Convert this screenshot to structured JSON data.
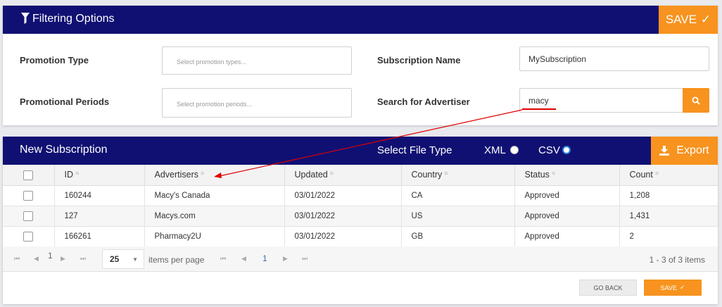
{
  "filter": {
    "title": "Filtering Options",
    "save_label": "SAVE",
    "promotion_type_label": "Promotion Type",
    "promotion_type_placeholder": "Select promotion types...",
    "promotional_periods_label": "Promotional Periods",
    "promotional_periods_placeholder": "Select promotion periods...",
    "subscription_name_label": "Subscription Name",
    "subscription_name_value": "MySubscription",
    "advertiser_label": "Search for Advertiser",
    "advertiser_value": "macy"
  },
  "subscription": {
    "title": "New Subscription",
    "file_type_label": "Select File Type",
    "options": [
      "XML",
      "CSV"
    ],
    "selected": "CSV",
    "export_label": "Export"
  },
  "table": {
    "columns": [
      "ID",
      "Advertisers",
      "Updated",
      "Country",
      "Status",
      "Count"
    ],
    "rows": [
      {
        "id": "160244",
        "advertiser": "Macy's Canada",
        "updated": "03/01/2022",
        "country": "CA",
        "status": "Approved",
        "count": "1,208"
      },
      {
        "id": "127",
        "advertiser": "Macys.com",
        "updated": "03/01/2022",
        "country": "US",
        "status": "Approved",
        "count": "1,431"
      },
      {
        "id": "166261",
        "advertiser": "Pharmacy2U",
        "updated": "03/01/2022",
        "country": "GB",
        "status": "Approved",
        "count": "2"
      }
    ]
  },
  "pager": {
    "page_left": "1",
    "page_size": "25",
    "items_per_page": "items per page",
    "page_center": "1",
    "summary": "1 - 3 of 3 items"
  },
  "footer": {
    "back_label": "GO BACK",
    "save_label": "SAVE"
  },
  "colors": {
    "navy": "#101073",
    "orange": "#f7931e",
    "annotation": "#e00000"
  }
}
